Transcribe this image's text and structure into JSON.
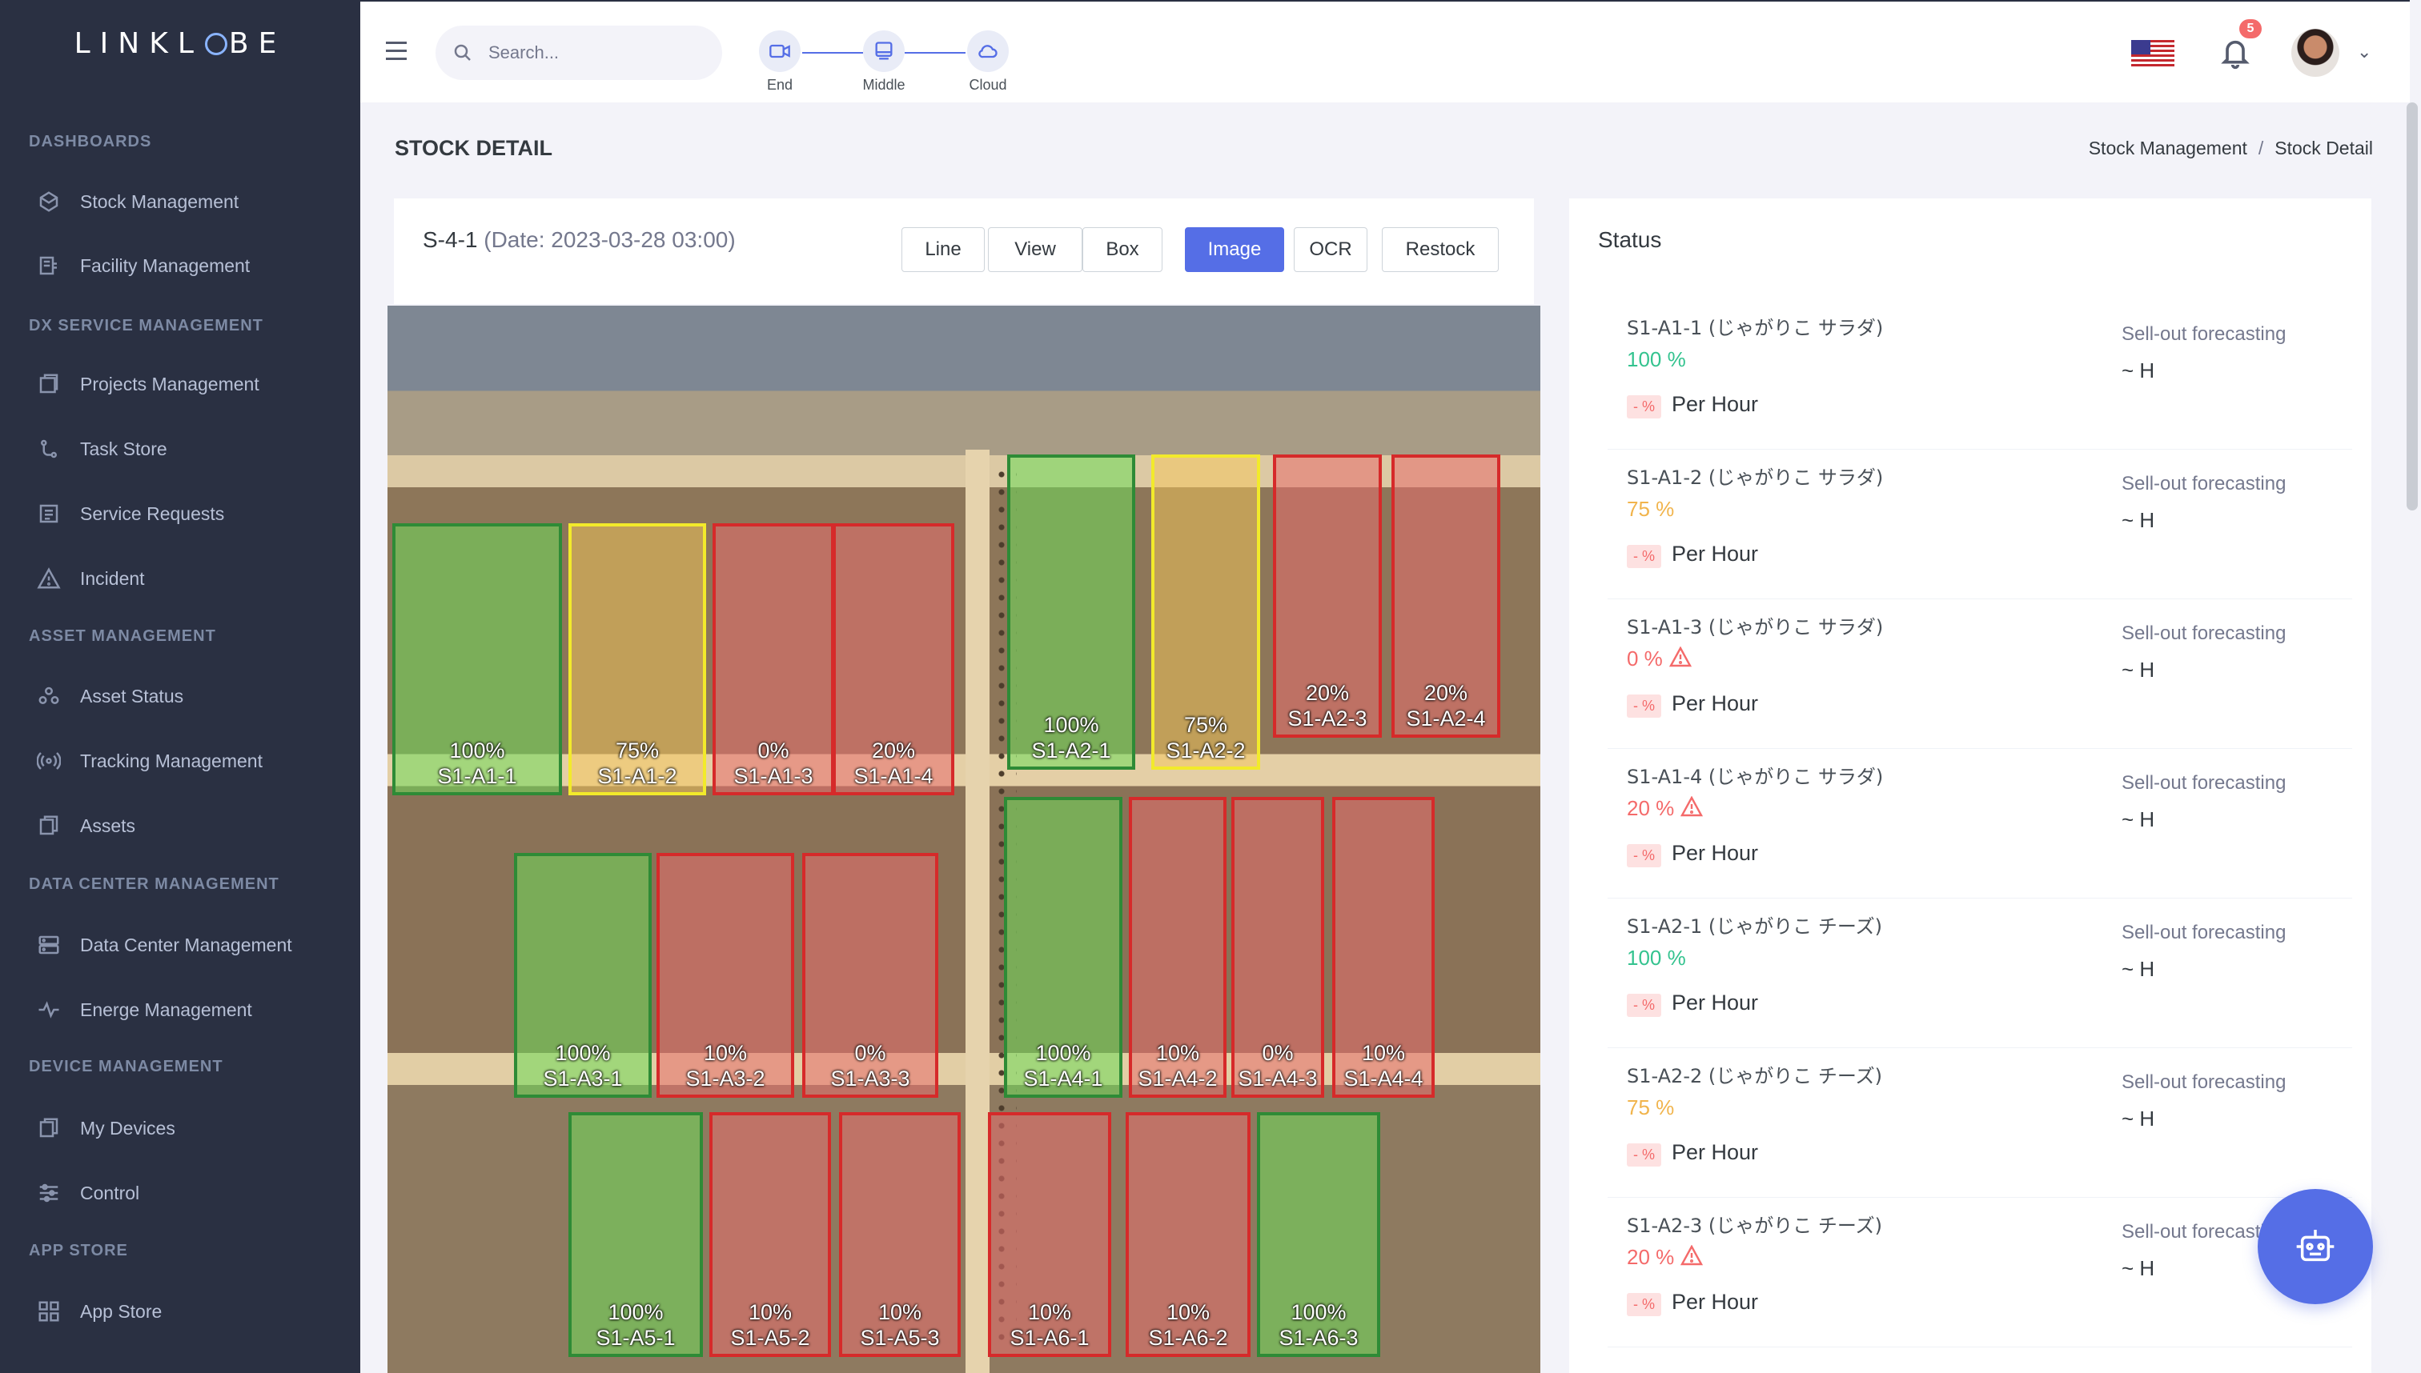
{
  "brand": {
    "logo_left": "LINKL",
    "logo_right": "BE"
  },
  "sidebar": {
    "sections": [
      {
        "title": "DASHBOARDS",
        "items": [
          "Stock Management",
          "Facility Management"
        ]
      },
      {
        "title": "DX SERVICE MANAGEMENT",
        "items": [
          "Projects Management",
          "Task Store",
          "Service Requests",
          "Incident"
        ]
      },
      {
        "title": "ASSET MANAGEMENT",
        "items": [
          "Asset Status",
          "Tracking Management",
          "Assets"
        ]
      },
      {
        "title": "DATA CENTER MANAGEMENT",
        "items": [
          "Data Center Management",
          "Energe Management"
        ]
      },
      {
        "title": "DEVICE MANAGEMENT",
        "items": [
          "My Devices",
          "Control"
        ]
      },
      {
        "title": "APP STORE",
        "items": [
          "App Store"
        ]
      }
    ]
  },
  "topbar": {
    "search_placeholder": "Search...",
    "steps": [
      "End",
      "Middle",
      "Cloud"
    ],
    "notification_count": "5"
  },
  "page": {
    "title": "STOCK DETAIL",
    "breadcrumb": [
      "Stock Management",
      "Stock Detail"
    ]
  },
  "detail": {
    "id": "S-4-1",
    "date": "(Date: 2023-03-28 03:00)",
    "buttons": [
      "Line",
      "View",
      "Box",
      "Image",
      "OCR",
      "Restock"
    ],
    "active_button": "Image"
  },
  "detections": [
    {
      "code": "S1-A1-1",
      "pct": "100%",
      "status": "green"
    },
    {
      "code": "S1-A1-2",
      "pct": "75%",
      "status": "yellow"
    },
    {
      "code": "S1-A1-3",
      "pct": "0%",
      "status": "red"
    },
    {
      "code": "S1-A1-4",
      "pct": "20%",
      "status": "red"
    },
    {
      "code": "S1-A2-1",
      "pct": "100%",
      "status": "green"
    },
    {
      "code": "S1-A2-2",
      "pct": "75%",
      "status": "yellow"
    },
    {
      "code": "S1-A2-3",
      "pct": "20%",
      "status": "red"
    },
    {
      "code": "S1-A2-4",
      "pct": "20%",
      "status": "red"
    },
    {
      "code": "S1-A3-1",
      "pct": "100%",
      "status": "green"
    },
    {
      "code": "S1-A3-2",
      "pct": "10%",
      "status": "red"
    },
    {
      "code": "S1-A3-3",
      "pct": "0%",
      "status": "red"
    },
    {
      "code": "S1-A4-1",
      "pct": "100%",
      "status": "green"
    },
    {
      "code": "S1-A4-2",
      "pct": "10%",
      "status": "red"
    },
    {
      "code": "S1-A4-3",
      "pct": "0%",
      "status": "red"
    },
    {
      "code": "S1-A4-4",
      "pct": "10%",
      "status": "red"
    },
    {
      "code": "S1-A5-1",
      "pct": "100%",
      "status": "green"
    },
    {
      "code": "S1-A5-2",
      "pct": "10%",
      "status": "red"
    },
    {
      "code": "S1-A5-3",
      "pct": "10%",
      "status": "red"
    },
    {
      "code": "S1-A6-1",
      "pct": "10%",
      "status": "red"
    },
    {
      "code": "S1-A6-2",
      "pct": "10%",
      "status": "red"
    },
    {
      "code": "S1-A6-3",
      "pct": "100%",
      "status": "green"
    }
  ],
  "status": {
    "title": "Status",
    "forecast_label": "Sell-out forecasting",
    "hours_text": "~ H",
    "tag_text": "- %",
    "unit_text": "Per Hour",
    "items": [
      {
        "name": "S1-A1-1 (じゃがりこ サラダ)",
        "pct": "100 %",
        "level": "green",
        "warning": false
      },
      {
        "name": "S1-A1-2 (じゃがりこ サラダ)",
        "pct": "75 %",
        "level": "orange",
        "warning": false
      },
      {
        "name": "S1-A1-3 (じゃがりこ サラダ)",
        "pct": "0 %",
        "level": "red",
        "warning": true
      },
      {
        "name": "S1-A1-4 (じゃがりこ サラダ)",
        "pct": "20 %",
        "level": "red",
        "warning": true
      },
      {
        "name": "S1-A2-1 (じゃがりこ チーズ)",
        "pct": "100 %",
        "level": "green",
        "warning": false
      },
      {
        "name": "S1-A2-2 (じゃがりこ チーズ)",
        "pct": "75 %",
        "level": "orange",
        "warning": false
      },
      {
        "name": "S1-A2-3 (じゃがりこ チーズ)",
        "pct": "20 %",
        "level": "red",
        "warning": true
      }
    ]
  },
  "colors": {
    "accent": "#556ee6",
    "sidebar": "#2a3042",
    "ok": "#34c38f",
    "warn": "#f1b44c",
    "danger": "#f46a6a"
  }
}
